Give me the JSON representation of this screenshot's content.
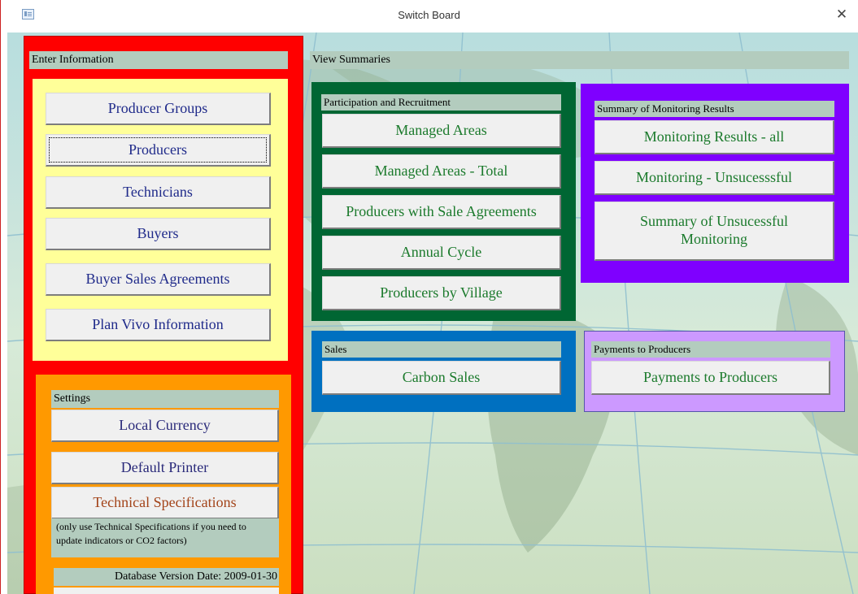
{
  "window": {
    "title": "Switch Board"
  },
  "enter": {
    "header": "Enter Information",
    "buttons": [
      "Producer Groups",
      "Producers",
      "Technicians",
      "Buyers",
      "Buyer Sales Agreements",
      "Plan Vivo Information"
    ]
  },
  "settings": {
    "header": "Settings",
    "local_currency": "Local Currency",
    "default_printer": "Default Printer",
    "tech_specs": "Technical Specifications",
    "tech_note": "(only use Technical Specifications  if you need to update indicators or CO2 factors)",
    "db_version": "Database Version Date: 2009-01-30"
  },
  "summaries": {
    "header": "View Summaries"
  },
  "participation": {
    "header": "Participation and Recruitment",
    "buttons": [
      "Managed Areas",
      "Managed Areas - Total",
      "Producers with Sale Agreements",
      "Annual Cycle",
      "Producers by Village"
    ]
  },
  "monitoring": {
    "header": "Summary of Monitoring Results",
    "buttons": [
      "Monitoring Results - all",
      "Monitoring - Unsucesssful",
      "Summary of Unsucessful Monitoring"
    ]
  },
  "sales": {
    "header": "Sales",
    "button": "Carbon Sales"
  },
  "payments": {
    "header": "Payments to Producers",
    "button": "Payments to Producers"
  },
  "colors": {
    "enter_frame": "#ff0000",
    "enter_inner": "#ffff99",
    "settings_frame": "#ff9900",
    "participation_frame": "#006633",
    "monitoring_frame": "#7f00ff",
    "sales_frame": "#0070c0",
    "payments_frame": "#cc99ff"
  },
  "icons": {
    "form": "form-icon",
    "close": "close-icon"
  }
}
